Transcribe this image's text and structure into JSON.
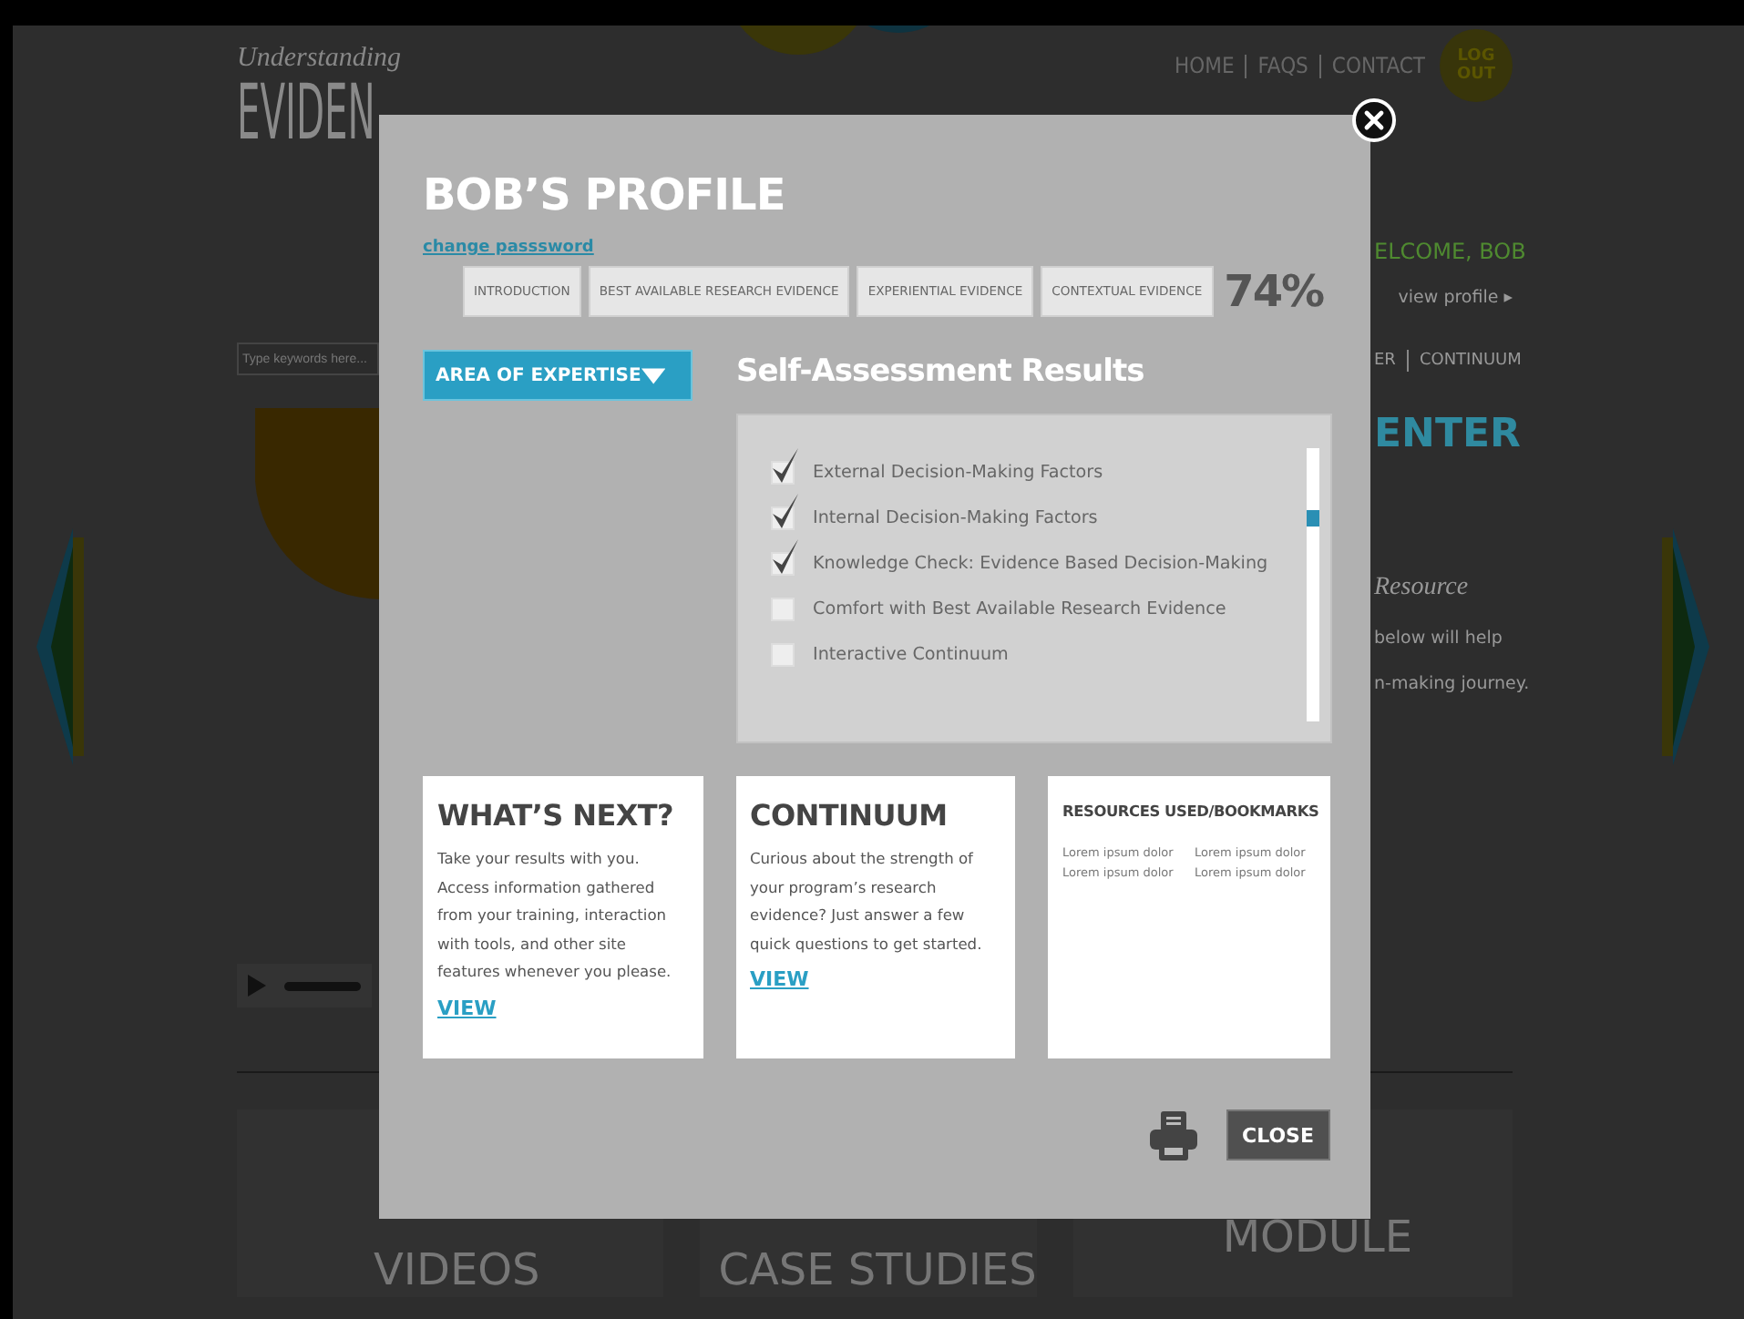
{
  "background_page": {
    "logo": {
      "tagline": "Understanding",
      "wordmark": "EVIDEN"
    },
    "nav": [
      {
        "label": "HOME"
      },
      {
        "label": "FAQS"
      },
      {
        "label": "CONTACT"
      }
    ],
    "logout": "LOG OUT",
    "welcome": "ELCOME, BOB",
    "view_profile": "view profile ▸",
    "search": {
      "placeholder": "Type keywords here..."
    },
    "submenu": [
      {
        "label": "ER"
      },
      {
        "label": "CONTINUUM"
      }
    ],
    "section_title": "ENTER",
    "intro": {
      "heading": "Resource",
      "lines": [
        "below will help",
        "n-making journey."
      ]
    },
    "tiles": [
      {
        "label": "VIDEOS"
      },
      {
        "label": "CASE STUDIES"
      },
      {
        "label": "MODULE"
      }
    ]
  },
  "modal": {
    "title": "BOB’S PROFILE",
    "change_password": "change passsword",
    "tabs": [
      {
        "label": "INTRODUCTION",
        "selected": false
      },
      {
        "label": "BEST AVAILABLE RESEARCH EVIDENCE",
        "selected": false
      },
      {
        "label": "EXPERIENTIAL EVIDENCE",
        "selected": false
      },
      {
        "label": "CONTEXTUAL EVIDENCE",
        "selected": false
      }
    ],
    "progress": "74%",
    "dropdown": {
      "label": "AREA OF EXPERTISE"
    },
    "results": {
      "title": "Self-Assessment Results",
      "items": [
        {
          "label": "External Decision-Making Factors",
          "checked": true
        },
        {
          "label": "Internal Decision-Making Factors",
          "checked": true
        },
        {
          "label": "Knowledge Check: Evidence Based Decision-Making",
          "checked": true
        },
        {
          "label": "Comfort with Best Available Research Evidence",
          "checked": false
        },
        {
          "label": "Interactive Continuum",
          "checked": false
        }
      ]
    },
    "cards": [
      {
        "kind": "text",
        "title": "WHAT’S NEXT?",
        "body": "Take your results with you. Access information gathered from your training, interaction with tools, and other site features whenever you please.",
        "link": "VIEW"
      },
      {
        "kind": "text",
        "title": "CONTINUUM",
        "body": "Curious about the strength of your program’s research evidence? Just answer a few quick questions to get started.",
        "link": "VIEW"
      },
      {
        "kind": "links",
        "title": "RESOURCES USED/BOOKMARKS",
        "links": [
          "Lorem ipsum dolor",
          "Lorem ipsum dolor",
          "Lorem ipsum dolor",
          "Lorem ipsum dolor"
        ]
      }
    ],
    "close_label": "CLOSE"
  }
}
